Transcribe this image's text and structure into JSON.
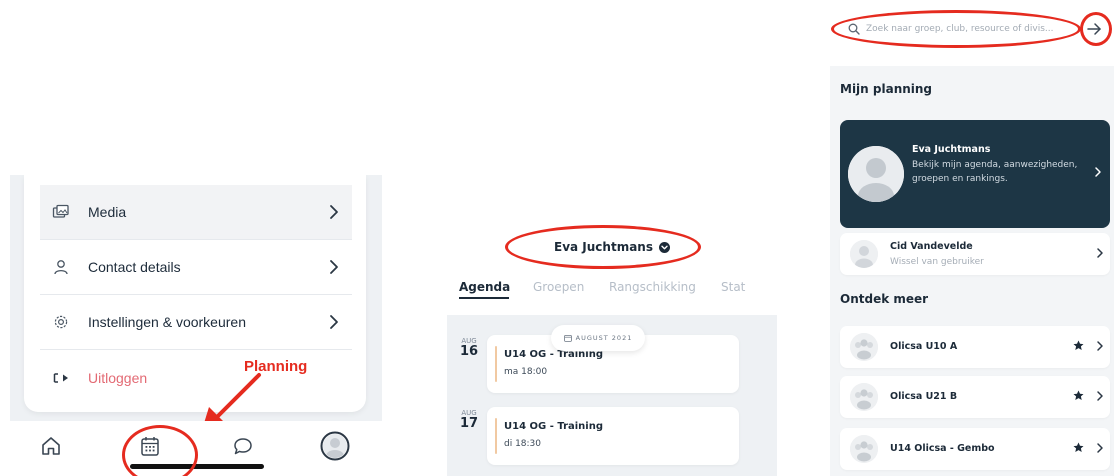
{
  "panel1": {
    "menu_items": [
      {
        "label": "Media",
        "icon": "media-icon"
      },
      {
        "label": "Contact details",
        "icon": "user-icon"
      },
      {
        "label": "Instellingen & voorkeuren",
        "icon": "gear-icon"
      },
      {
        "label": "Uitloggen",
        "icon": "logout-icon"
      }
    ],
    "annotation_label": "Planning",
    "tabs": [
      "home-icon",
      "calendar-icon",
      "chat-icon",
      "profile-icon"
    ],
    "colors": {
      "logout": "#e36a74",
      "annotation": "#e52b1f"
    }
  },
  "panel2": {
    "user_name": "Eva Juchtmans",
    "tabs": [
      "Agenda",
      "Groepen",
      "Rangschikking",
      "Stat"
    ],
    "month_pill": "AUGUST 2021",
    "events": [
      {
        "month": "AUG",
        "day": "16",
        "title": "U14 OG - Training",
        "time": "ma 18:00"
      },
      {
        "month": "AUG",
        "day": "17",
        "title": "U14 OG - Training",
        "time": "di 18:30"
      }
    ]
  },
  "panel3": {
    "search": {
      "placeholder": "Zoek naar groep, club, resource of divis..."
    },
    "my_planning_title": "Mijn planning",
    "profile": {
      "name": "Eva Juchtmans",
      "description": "Bekijk mijn agenda, aanwezigheden, groepen en rankings."
    },
    "switch_user": {
      "name": "Cid Vandevelde",
      "subtitle": "Wissel van gebruiker"
    },
    "discover_title": "Ontdek meer",
    "groups": [
      {
        "name": "Olicsa U10 A"
      },
      {
        "name": "Olicsa U21 B"
      },
      {
        "name": "U14 Olicsa - Gembo"
      }
    ],
    "colors": {
      "profile_card": "#1d3645"
    }
  }
}
